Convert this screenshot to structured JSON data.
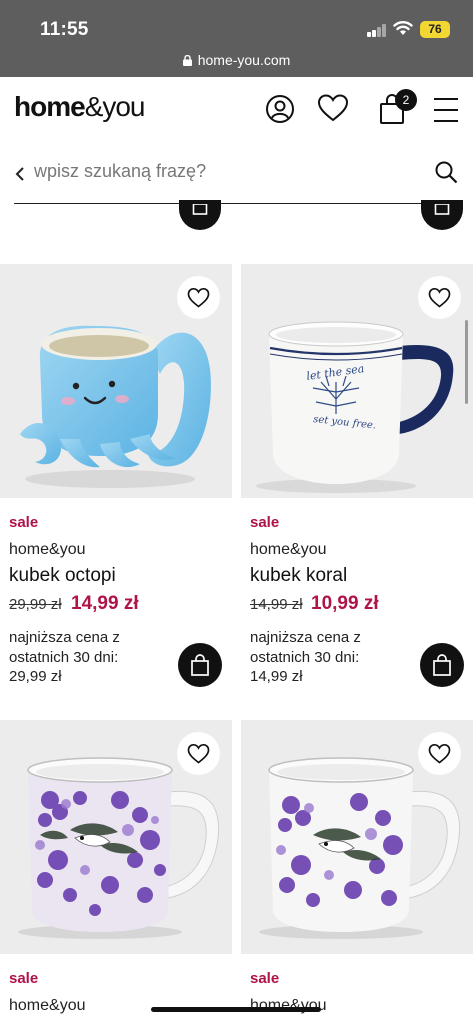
{
  "status_bar": {
    "time": "11:55",
    "battery": "76"
  },
  "browser": {
    "url": "home-you.com"
  },
  "header": {
    "logo_bold": "home",
    "logo_light": "&you",
    "cart_count": "2"
  },
  "search": {
    "placeholder": "wpisz szukaną frazę?"
  },
  "products": [
    {
      "sale_label": "sale",
      "brand": "home&you",
      "name": "kubek octopi",
      "old_price": "29,99 zł",
      "new_price": "14,99 zł",
      "lowest_line1": "najniższa cena z",
      "lowest_line2": "ostatnich 30 dni:",
      "lowest_line3": "29,99 zł"
    },
    {
      "sale_label": "sale",
      "brand": "home&you",
      "name": "kubek koral",
      "old_price": "14,99 zł",
      "new_price": "10,99 zł",
      "lowest_line1": "najniższa cena z",
      "lowest_line2": "ostatnich 30 dni:",
      "lowest_line3": "14,99 zł",
      "mug_text_line1": "let the sea",
      "mug_text_line2": "set you free."
    },
    {
      "sale_label": "sale",
      "brand": "home&you"
    },
    {
      "sale_label": "sale",
      "brand": "home&you"
    }
  ],
  "colors": {
    "accent": "#b0124a",
    "dark": "#111111",
    "card_bg": "#ececec"
  },
  "icons": [
    "lock-icon",
    "user-icon",
    "heart-icon",
    "shopping-bag-icon",
    "menu-icon",
    "chevron-left-icon",
    "search-icon"
  ]
}
